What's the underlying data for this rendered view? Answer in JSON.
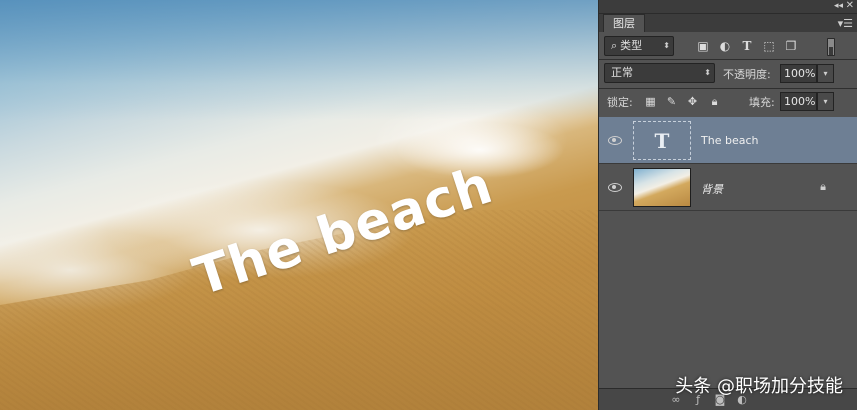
{
  "canvas": {
    "text_layer_content": "The beach"
  },
  "watermark": "头条 @职场加分技能",
  "panel": {
    "collapse_icon": "double-chevron-right",
    "close_icon": "close",
    "tab_label": "图层",
    "menu_icon": "panel-menu",
    "filter": {
      "search_icon": "magnifier",
      "selected": "类型",
      "icons": [
        "image-filter",
        "adjustment-filter",
        "type-filter",
        "shape-filter",
        "smart-object-filter"
      ]
    },
    "blend": {
      "mode": "正常",
      "opacity_label": "不透明度:",
      "opacity_value": "100%"
    },
    "lock": {
      "label": "锁定:",
      "icons": [
        "lock-transparent-pixels",
        "lock-image-pixels",
        "lock-position",
        "lock-all"
      ],
      "fill_label": "填充:",
      "fill_value": "100%"
    },
    "layers": [
      {
        "name": "The beach",
        "kind": "type",
        "thumb_glyph": "T",
        "visible": true,
        "selected": true,
        "locked": false
      },
      {
        "name": "背景",
        "kind": "image",
        "visible": true,
        "selected": false,
        "locked": true
      }
    ]
  },
  "colors": {
    "panel_bg": "#535353",
    "selected_layer": "#6e7f94",
    "text_on_canvas": "#ffffff"
  }
}
